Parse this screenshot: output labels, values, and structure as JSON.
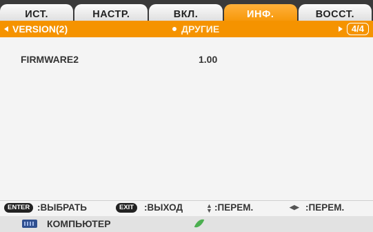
{
  "tabs": [
    "ИСТ.",
    "НАСТР.",
    "ВКЛ.",
    "ИНФ.",
    "ВОССТ."
  ],
  "active_tab_index": 3,
  "subbar": {
    "left_label": "VERSION(2)",
    "center_label": "ДРУГИЕ",
    "page": "4/4"
  },
  "info": {
    "label": "FIRMWARE2",
    "value": "1.00"
  },
  "help": {
    "enter_key": "ENTER",
    "enter_label": ":ВЫБРАТЬ",
    "exit_key": "EXIT",
    "exit_label": ":ВЫХОД",
    "updown_label": ":ПЕРЕМ.",
    "leftright_label": ":ПЕРЕМ."
  },
  "source": {
    "label": "КОМПЬЮТЕР",
    "icon": "computer-vga-icon",
    "eco_icon": "leaf-icon"
  },
  "colors": {
    "accent": "#f59300",
    "tab_bg": "#e6e6e6",
    "panel_bg": "#f4f4f4"
  }
}
